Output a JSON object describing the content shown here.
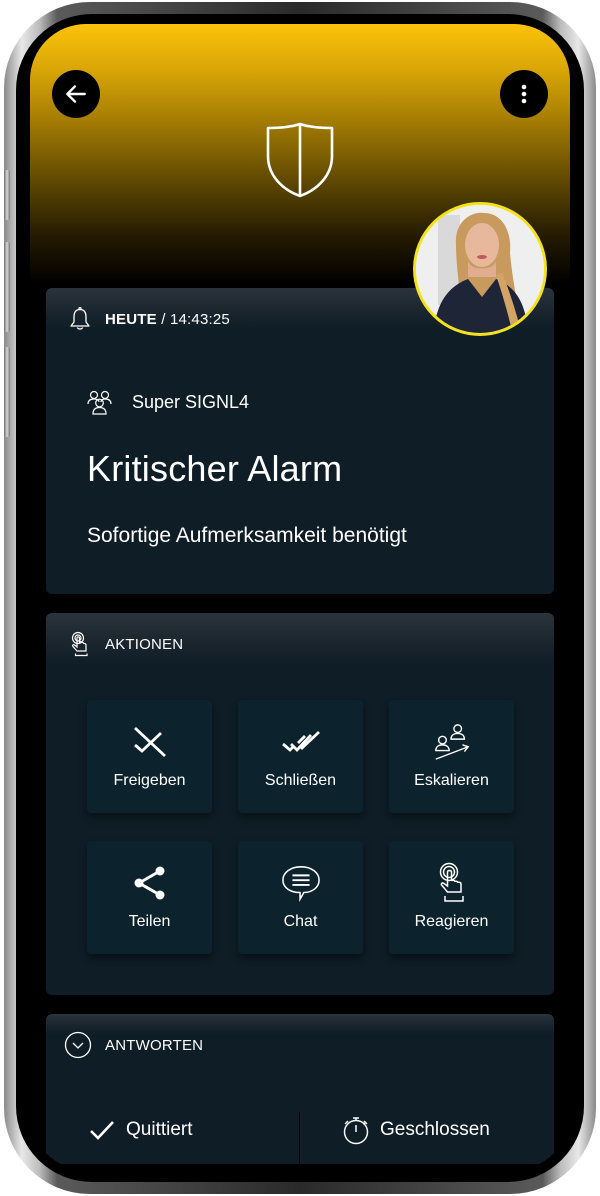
{
  "header": {
    "back_icon": "arrow-left-icon",
    "menu_icon": "more-vertical-icon",
    "hero_icon": "shield-icon",
    "accent_color": "#fcc30a",
    "avatar_ring_color": "#f4e21b"
  },
  "alarm": {
    "header_icon": "bell-icon",
    "day_label": "HEUTE",
    "separator": " / ",
    "time": "14:43:25",
    "team_icon": "team-icon",
    "team_name": "Super SIGNL4",
    "title": "Kritischer Alarm",
    "subtitle": "Sofortige Aufmerksamkeit benötigt"
  },
  "actions": {
    "header_icon": "touch-icon",
    "title": "AKTIONEN",
    "items": [
      {
        "label": "Freigeben",
        "icon": "check-crossed-icon"
      },
      {
        "label": "Schließen",
        "icon": "double-check-icon"
      },
      {
        "label": "Eskalieren",
        "icon": "escalate-users-icon"
      },
      {
        "label": "Teilen",
        "icon": "share-icon"
      },
      {
        "label": "Chat",
        "icon": "chat-bubble-icon"
      },
      {
        "label": "Reagieren",
        "icon": "tap-hand-icon"
      }
    ]
  },
  "answers": {
    "header_icon": "chevron-circle-down-icon",
    "title": "ANTWORTEN",
    "buttons": [
      {
        "label": "Quittiert",
        "icon": "checkmark-icon"
      },
      {
        "label": "Geschlossen",
        "icon": "stopwatch-icon"
      }
    ]
  }
}
